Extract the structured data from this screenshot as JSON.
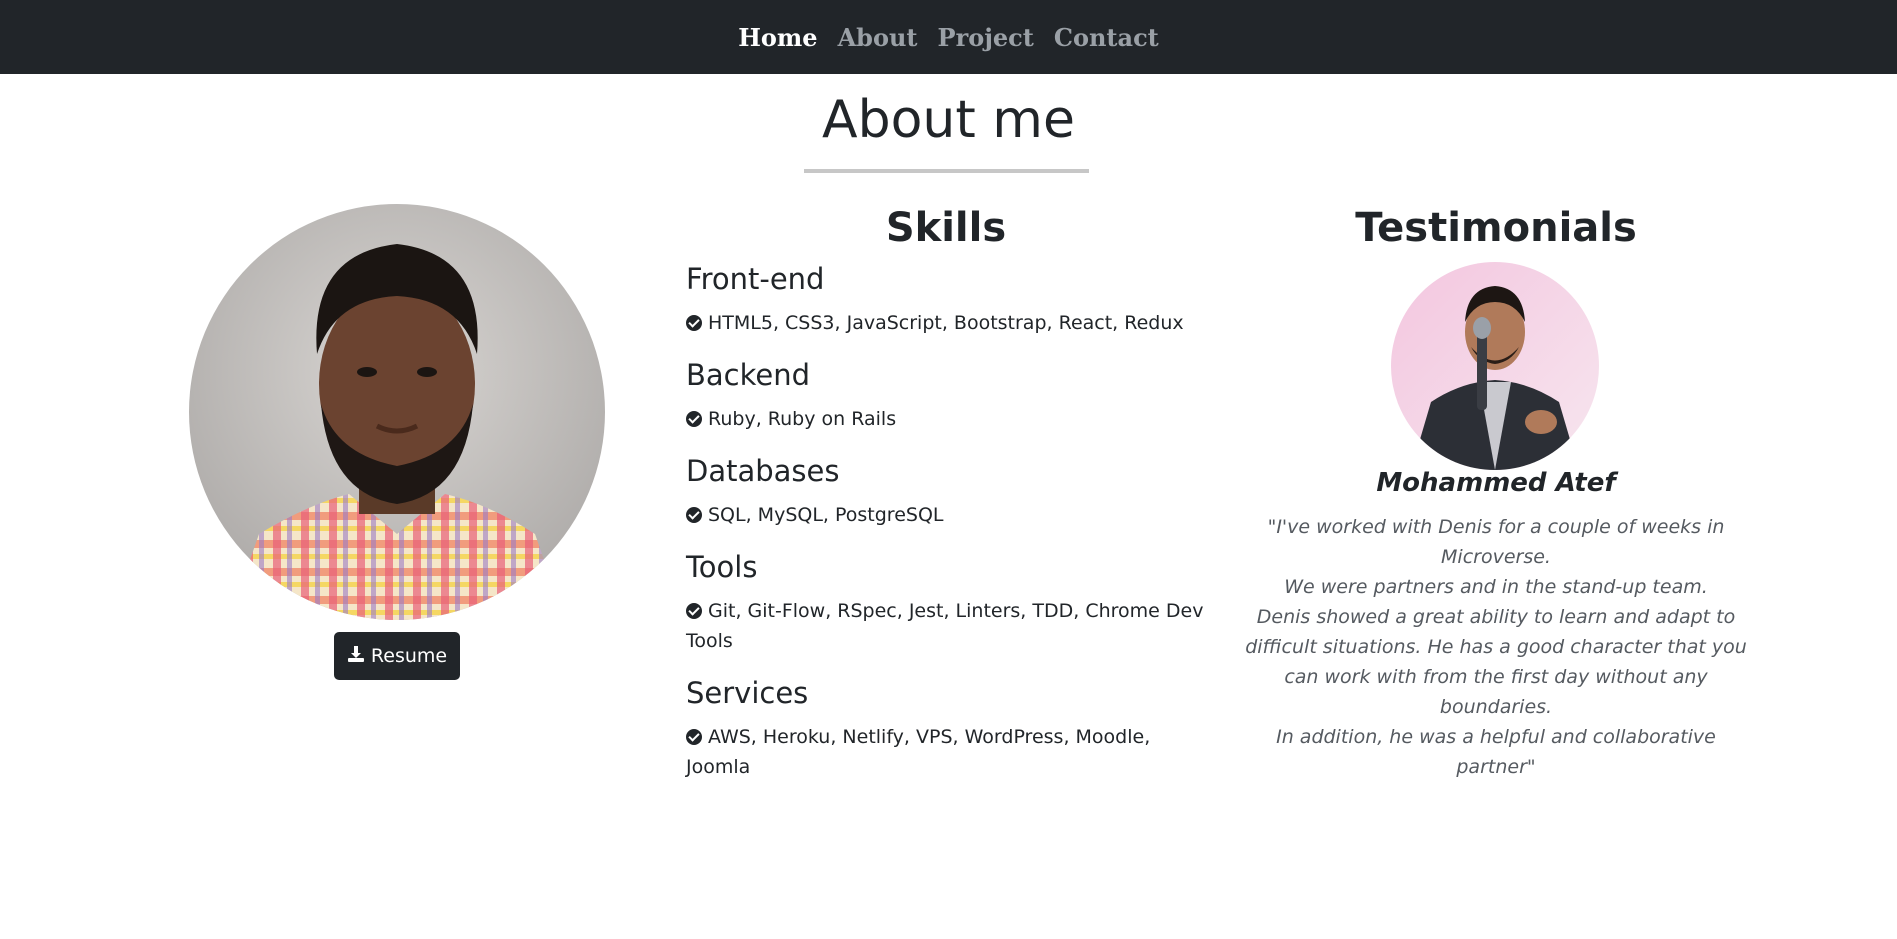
{
  "nav": {
    "items": [
      {
        "label": "Home",
        "active": true
      },
      {
        "label": "About",
        "active": false
      },
      {
        "label": "Project",
        "active": false
      },
      {
        "label": "Contact",
        "active": false
      }
    ]
  },
  "about": {
    "title": "About me"
  },
  "profile": {
    "photo_icon": "portrait-photo",
    "resume_label": "Resume",
    "resume_icon": "download-icon"
  },
  "skills": {
    "title": "Skills",
    "groups": [
      {
        "heading": "Front-end",
        "items": "HTML5, CSS3, JavaScript, Bootstrap, React, Redux"
      },
      {
        "heading": "Backend",
        "items": "Ruby, Ruby on Rails"
      },
      {
        "heading": "Databases",
        "items": "SQL, MySQL, PostgreSQL"
      },
      {
        "heading": "Tools",
        "items": "Git, Git-Flow, RSpec, Jest, Linters, TDD, Chrome Dev Tools"
      },
      {
        "heading": "Services",
        "items": "AWS, Heroku, Netlify, VPS, WordPress, Moodle, Joomla"
      }
    ]
  },
  "testimonials": {
    "title": "Testimonials",
    "name": "Mohammed Atef",
    "quote_lines": [
      "\"I've worked with Denis for a couple of weeks in Microverse.",
      "We were partners and in the stand-up team.",
      "Denis showed a great ability to learn and adapt to difficult situations. He has a good character that you can work with from the first day without any boundaries.",
      "In addition, he was a helpful and collaborative partner\""
    ]
  },
  "colors": {
    "navbar_bg": "#212529",
    "nav_active": "#ffffff",
    "nav_inactive": "#9aa0a6",
    "button_bg": "#212529",
    "quote_text": "#555a60",
    "underline": "#c7c7c7"
  }
}
